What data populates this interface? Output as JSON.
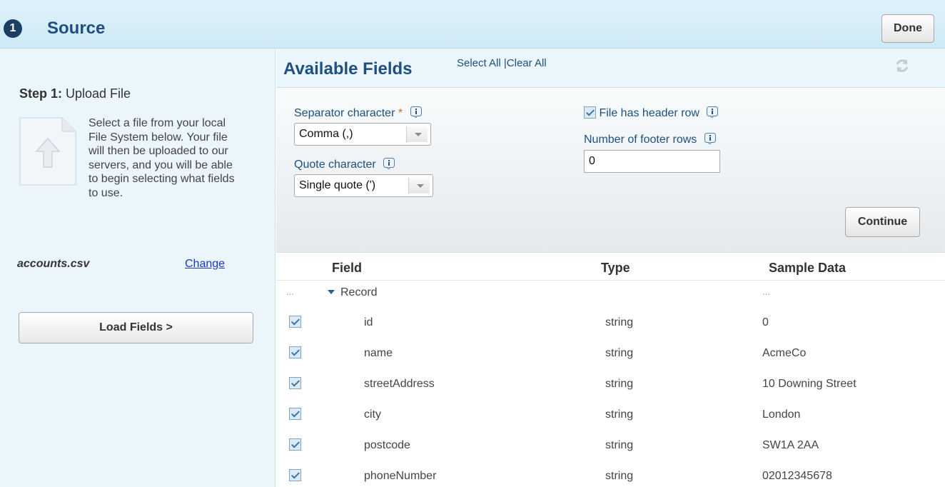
{
  "header": {
    "step_number": "1",
    "title": "Source",
    "done_label": "Done"
  },
  "left": {
    "step_label_bold": "Step 1:",
    "step_label_text": " Upload File",
    "description": "Select a file from your local File System below. Your file will then be uploaded to our servers, and you will be able to begin selecting what fields to use.",
    "filename": "accounts.csv",
    "change_label": "Change",
    "load_fields_label": "Load Fields >"
  },
  "available": {
    "title": "Available Fields",
    "select_all": "Select All",
    "separator": " |",
    "clear_all": "Clear All"
  },
  "settings": {
    "separator_label": "Separator character",
    "required_mark": "*",
    "separator_value": "Comma (,)",
    "quote_label": "Quote character",
    "quote_value": "Single quote (')",
    "header_row_label": "File has header row",
    "header_row_checked": true,
    "footer_rows_label": "Number of footer rows",
    "footer_rows_value": "0",
    "continue_label": "Continue"
  },
  "table": {
    "columns": [
      "Field",
      "Type",
      "Sample Data"
    ],
    "group_row": {
      "ellipsis": "...",
      "name": "Record",
      "sample": "..."
    },
    "rows": [
      {
        "field": "id",
        "type": "string",
        "sample": "0",
        "checked": true
      },
      {
        "field": "name",
        "type": "string",
        "sample": "AcmeCo",
        "checked": true
      },
      {
        "field": "streetAddress",
        "type": "string",
        "sample": "10 Downing Street",
        "checked": true
      },
      {
        "field": "city",
        "type": "string",
        "sample": "London",
        "checked": true
      },
      {
        "field": "postcode",
        "type": "string",
        "sample": "SW1A 2AA",
        "checked": true
      },
      {
        "field": "phoneNumber",
        "type": "string",
        "sample": "02012345678",
        "checked": true
      }
    ]
  },
  "colors": {
    "title_blue": "#1e4f80",
    "header_bg": "#d8eef9",
    "panel_bg": "#eaf5fc",
    "link_blue": "#1a36c8",
    "required_orange": "#e06a00"
  },
  "icons": [
    "upload-file-icon",
    "refresh-icon",
    "info-icon",
    "checkbox-icon",
    "caret-down-icon"
  ]
}
